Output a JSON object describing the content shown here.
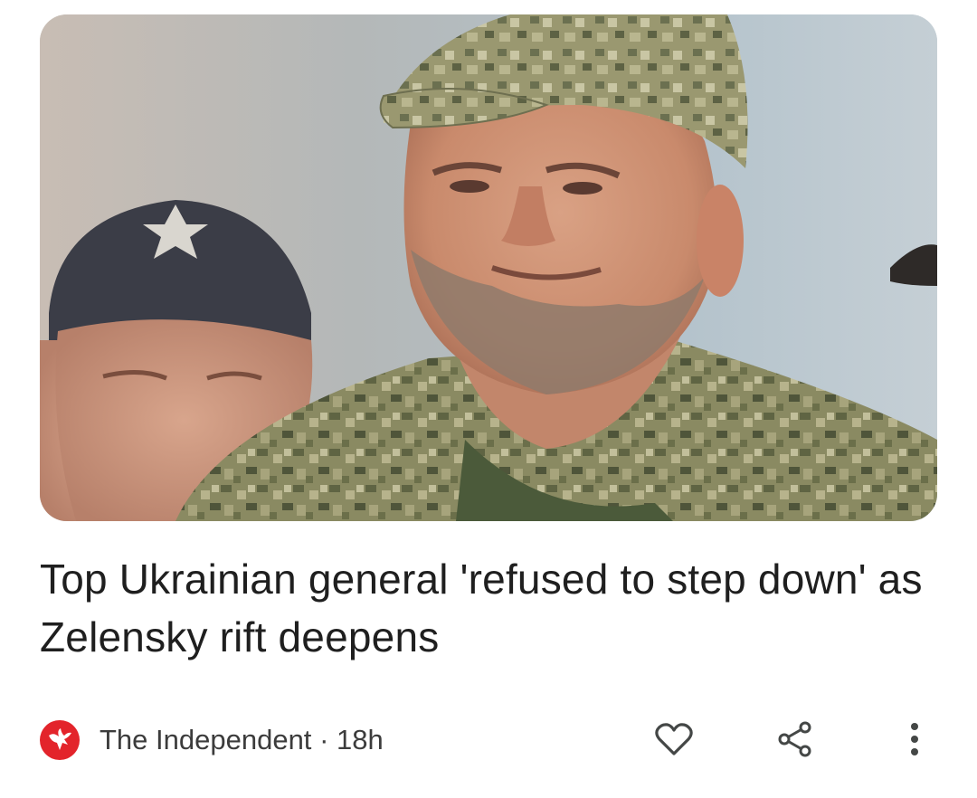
{
  "article": {
    "image": {
      "alt": "Top Ukrainian general in camouflage uniform and cap",
      "subject_icon": "photo-military-general"
    },
    "headline": "Top Ukrainian general 'refused to step down' as Zelensky rift deepens",
    "source": {
      "name": "The Independent",
      "separator": "·",
      "age": "18h",
      "logo_icon": "independent-eagle-logo",
      "logo_color": "#e3242b"
    },
    "actions": {
      "like_icon": "heart-outline-icon",
      "share_icon": "share-icon",
      "more_icon": "more-vertical-icon"
    }
  },
  "colors": {
    "text": "#1f1f1f",
    "meta_text": "#3c3c3c",
    "icon": "#444746",
    "background": "#ffffff"
  }
}
